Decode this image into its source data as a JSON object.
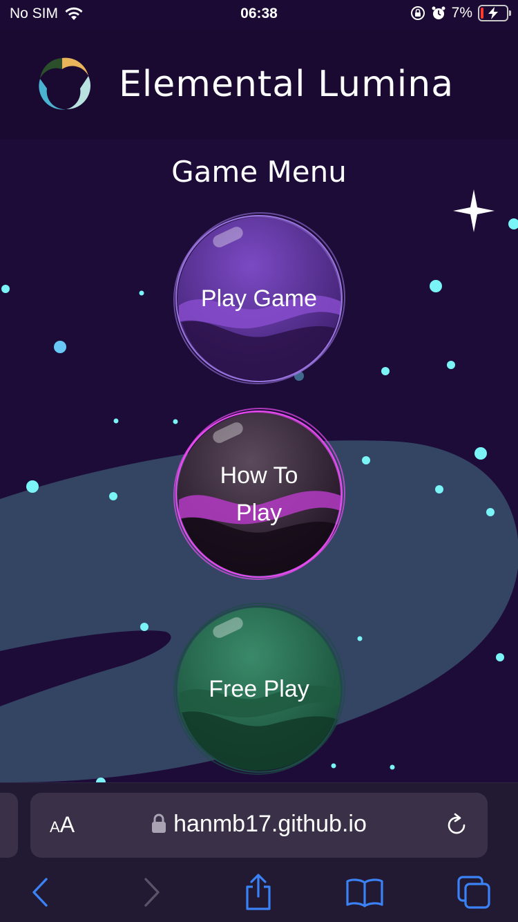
{
  "status_bar": {
    "carrier": "No SIM",
    "time": "06:38",
    "battery_percent": "7%",
    "battery_level": 0.07,
    "icons": [
      "wifi-icon",
      "orientation-lock-icon",
      "alarm-icon",
      "battery-icon",
      "charging-bolt-icon"
    ]
  },
  "header": {
    "title": "Elemental Lumina",
    "logo_colors": [
      "#e9b45a",
      "#2a4f2a",
      "#4ab3cf",
      "#b9e1e0"
    ]
  },
  "menu": {
    "title": "Game Menu",
    "buttons": [
      {
        "label": "Play Game",
        "color": "#6a3bb1"
      },
      {
        "label": "How To Play",
        "color": "#4a3b4e",
        "ring_color": "#e84bf0"
      },
      {
        "label": "Free Play",
        "color": "#2a7a5a"
      }
    ]
  },
  "colors": {
    "background": "#1d0c37",
    "header": "#1a0a32",
    "planet_band": "#344564",
    "stars": "#7af4f7"
  },
  "browser": {
    "text_size_label_small": "A",
    "text_size_label_large": "A",
    "url": "hanmb17.github.io",
    "icons": [
      "lock-icon",
      "reload-icon",
      "back-arrow-icon",
      "forward-arrow-icon",
      "share-icon",
      "bookmarks-icon",
      "tabs-icon"
    ]
  }
}
